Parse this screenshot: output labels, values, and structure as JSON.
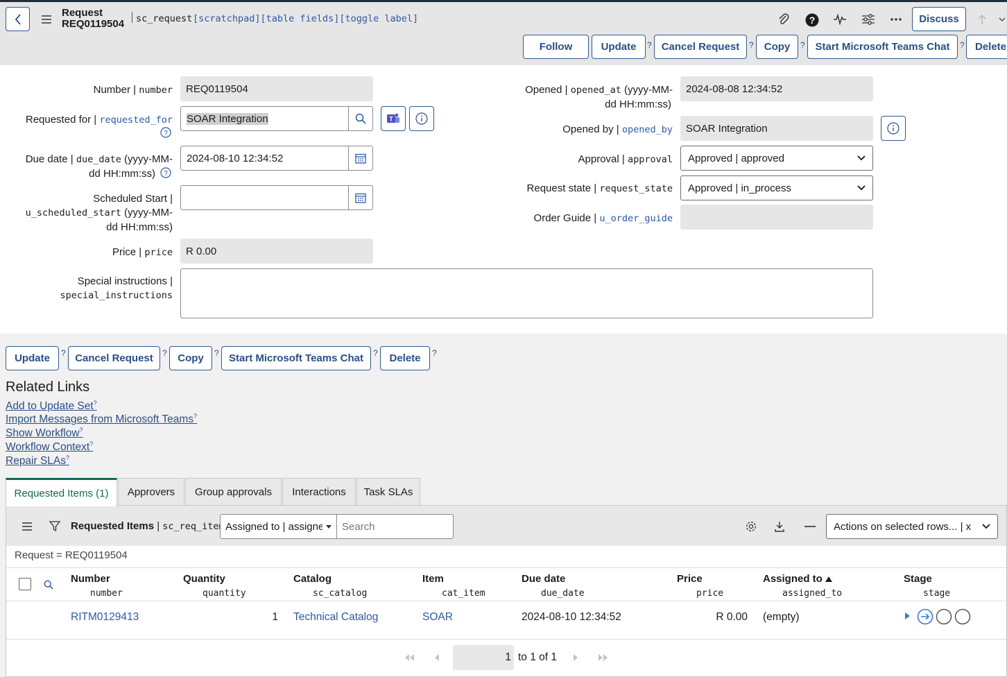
{
  "header": {
    "title_line1": "Request",
    "title_line2": "REQ0119504",
    "table": "sc_request",
    "debug_links": "[scratchpad][table fields][toggle label]",
    "discuss": "Discuss",
    "buttons": {
      "follow": "Follow",
      "update": "Update",
      "cancel": "Cancel Request",
      "copy": "Copy",
      "teams": "Start Microsoft Teams Chat",
      "delete": "Delete"
    }
  },
  "form": {
    "number": {
      "label": "Number | ",
      "field": "number",
      "value": "REQ0119504"
    },
    "requested_for": {
      "label": "Requested for | ",
      "field": "requested_for",
      "value": "SOAR Integration"
    },
    "due_date": {
      "label": "Due date | ",
      "field": "due_date",
      "suffix1": " (yyyy-MM-",
      "suffix2": "dd HH:mm:ss)",
      "value": "2024-08-10 12:34:52"
    },
    "scheduled_start": {
      "label": "Scheduled Start |",
      "field": "u_scheduled_start",
      "suffix1": " (yyyy-MM-",
      "suffix2": "dd HH:mm:ss)",
      "value": ""
    },
    "price": {
      "label": "Price | ",
      "field": "price",
      "value": "R 0.00"
    },
    "special_instructions": {
      "label": "Special instructions |",
      "field": "special_instructions",
      "value": ""
    },
    "opened": {
      "label": "Opened | ",
      "field": "opened_at",
      "suffix1": " (yyyy-MM-",
      "suffix2": "dd HH:mm:ss)",
      "value": "2024-08-08 12:34:52"
    },
    "opened_by": {
      "label": "Opened by | ",
      "field": "opened_by",
      "value": "SOAR Integration"
    },
    "approval": {
      "label": "Approval | ",
      "field": "approval",
      "value": "Approved | approved"
    },
    "request_state": {
      "label": "Request state | ",
      "field": "request_state",
      "value": "Approved | in_process"
    },
    "order_guide": {
      "label": "Order Guide | ",
      "field": "u_order_guide",
      "value": ""
    }
  },
  "bottom_buttons": {
    "update": "Update",
    "cancel": "Cancel Request",
    "copy": "Copy",
    "teams": "Start Microsoft Teams Chat",
    "delete": "Delete"
  },
  "related_links": {
    "title": "Related Links",
    "items": [
      "Add to Update Set",
      "Import Messages from Microsoft Teams",
      "Show Workflow",
      "Workflow Context",
      "Repair SLAs"
    ]
  },
  "tabs": [
    "Requested Items (1)",
    "Approvers",
    "Group approvals",
    "Interactions",
    "Task SLAs"
  ],
  "list": {
    "title": "Requested Items",
    "table": "sc_req_item",
    "search_field": "Assigned to | assigne",
    "search_placeholder": "Search",
    "actions": "Actions on selected rows... | x",
    "breadcrumb": "Request = REQ0119504",
    "columns": [
      {
        "label": "Number",
        "field": "number"
      },
      {
        "label": "Quantity",
        "field": "quantity"
      },
      {
        "label": "Catalog",
        "field": "sc_catalog"
      },
      {
        "label": "Item",
        "field": "cat_item"
      },
      {
        "label": "Due date",
        "field": "due_date"
      },
      {
        "label": "Price",
        "field": "price"
      },
      {
        "label": "Assigned to",
        "field": "assigned_to"
      },
      {
        "label": "Stage",
        "field": "stage"
      }
    ],
    "rows": [
      {
        "number": "RITM0129413",
        "quantity": "1",
        "catalog": "Technical Catalog",
        "item": "SOAR",
        "due_date": "2024-08-10 12:34:52",
        "price": "R 0.00",
        "assigned_to": "(empty)"
      }
    ],
    "pagination": {
      "page": "1",
      "summary": "to 1 of 1"
    }
  },
  "colors": {
    "accent": "#2a4f87",
    "link": "#2c5aa5",
    "active_tab": "#0e6a55",
    "stage_active": "#2f7de1"
  }
}
